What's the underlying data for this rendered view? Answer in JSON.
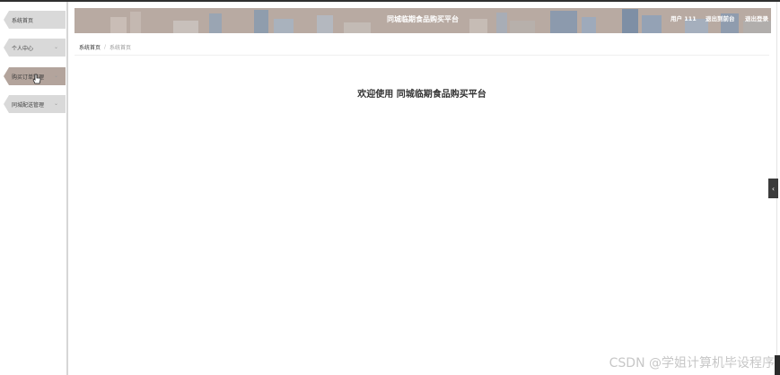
{
  "header": {
    "title": "同城临期食品购买平台",
    "user": "用户 111",
    "exit_backend": "退出到前台",
    "logout": "退出登录"
  },
  "sidebar": {
    "items": [
      {
        "label": "系统首页",
        "has_submenu": false
      },
      {
        "label": "个人中心",
        "has_submenu": true
      },
      {
        "label": "购买订单管理",
        "has_submenu": true
      },
      {
        "label": "同城配送管理",
        "has_submenu": true
      }
    ]
  },
  "breadcrumb": {
    "home": "系统首页",
    "current": "系统首页"
  },
  "main": {
    "welcome": "欢迎使用 同城临期食品购买平台"
  },
  "watermark": "CSDN @学姐计算机毕设程序",
  "colors": {
    "header_bg": "#b8aaa2",
    "active_nav": "#b3a49c",
    "nav_bg": "#d9d9d9"
  }
}
